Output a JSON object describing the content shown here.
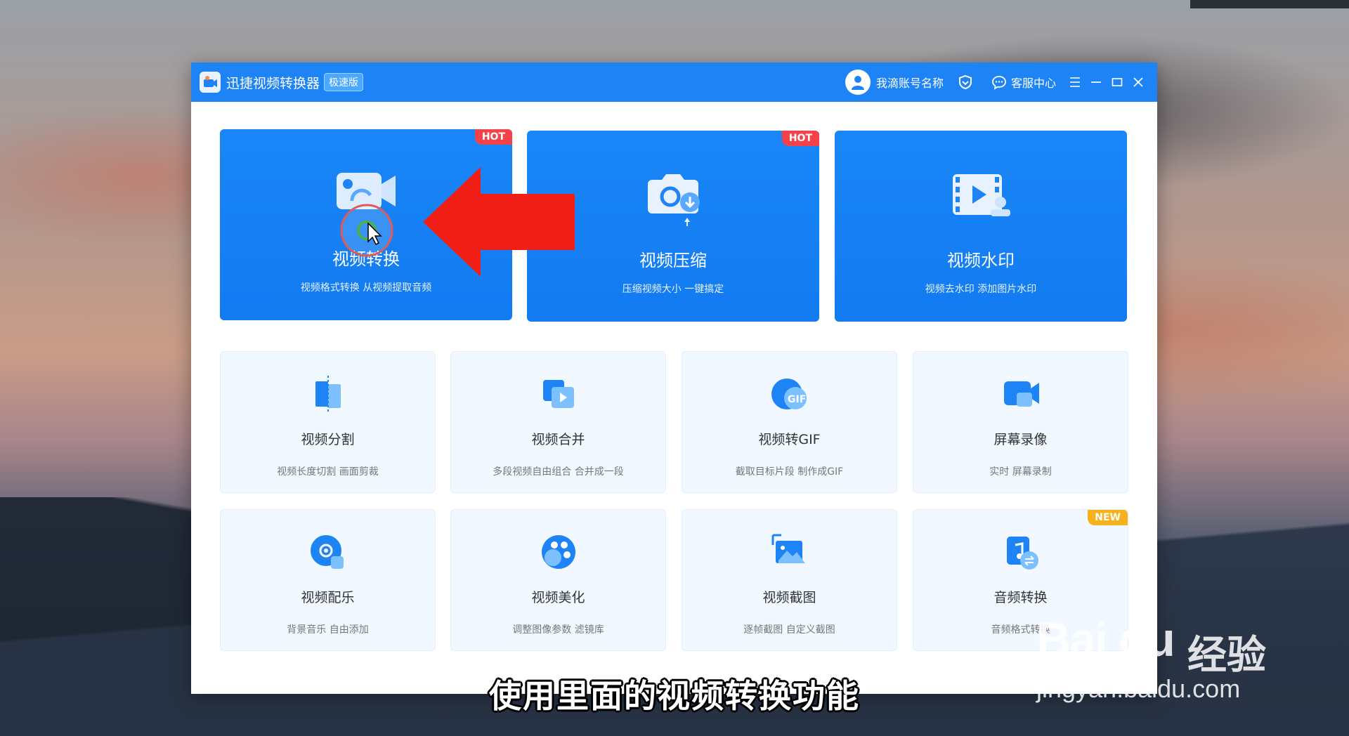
{
  "window": {
    "app_title": "迅捷视频转换器",
    "edition": "极速版",
    "account_name": "我滴账号名称",
    "service_label": "客服中心"
  },
  "feature_cards": [
    {
      "title": "视频转换",
      "desc": "视频格式转换 从视频提取音频",
      "badge": "HOT",
      "icon": "video-camera-convert-icon"
    },
    {
      "title": "视频压缩",
      "desc": "压缩视频大小 一键搞定",
      "badge": "HOT",
      "icon": "camera-compress-icon"
    },
    {
      "title": "视频水印",
      "desc": "视频去水印 添加图片水印",
      "badge": "",
      "icon": "video-watermark-icon"
    }
  ],
  "tool_cards": [
    {
      "title": "视频分割",
      "desc": "视频长度切割 画面剪裁",
      "badge": "",
      "icon": "video-split-icon"
    },
    {
      "title": "视频合并",
      "desc": "多段视频自由组合 合并成一段",
      "badge": "",
      "icon": "video-merge-icon"
    },
    {
      "title": "视频转GIF",
      "desc": "截取目标片段 制作成GIF",
      "badge": "",
      "icon": "gif-icon"
    },
    {
      "title": "屏幕录像",
      "desc": "实时 屏幕录制",
      "badge": "",
      "icon": "screen-record-icon"
    },
    {
      "title": "视频配乐",
      "desc": "背景音乐 自由添加",
      "badge": "",
      "icon": "music-disc-icon"
    },
    {
      "title": "视频美化",
      "desc": "调整图像参数 滤镜库",
      "badge": "",
      "icon": "palette-icon"
    },
    {
      "title": "视频截图",
      "desc": "逐帧截图 自定义截图",
      "badge": "",
      "icon": "screenshot-icon"
    },
    {
      "title": "音频转换",
      "desc": "音频格式转换",
      "badge": "NEW",
      "icon": "audio-convert-icon"
    }
  ],
  "overlay": {
    "subtitle": "使用里面的视频转换功能",
    "watermark_brand": "Bai du",
    "watermark_cn": "经验",
    "watermark_url": "jingyan.baidu.com"
  },
  "colors": {
    "brand_blue": "#1e83f4",
    "hot_red": "#f5424a",
    "new_orange": "#f7b11a",
    "arrow_red": "#f01e14"
  }
}
